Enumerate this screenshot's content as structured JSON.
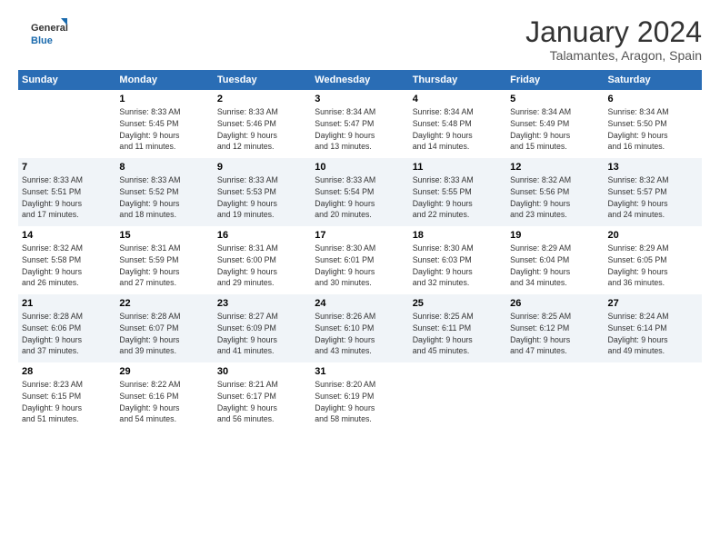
{
  "logo": {
    "line1": "General",
    "line2": "Blue"
  },
  "title": "January 2024",
  "subtitle": "Talamantes, Aragon, Spain",
  "days_header": [
    "Sunday",
    "Monday",
    "Tuesday",
    "Wednesday",
    "Thursday",
    "Friday",
    "Saturday"
  ],
  "weeks": [
    [
      {
        "day": "",
        "info": ""
      },
      {
        "day": "1",
        "info": "Sunrise: 8:33 AM\nSunset: 5:45 PM\nDaylight: 9 hours\nand 11 minutes."
      },
      {
        "day": "2",
        "info": "Sunrise: 8:33 AM\nSunset: 5:46 PM\nDaylight: 9 hours\nand 12 minutes."
      },
      {
        "day": "3",
        "info": "Sunrise: 8:34 AM\nSunset: 5:47 PM\nDaylight: 9 hours\nand 13 minutes."
      },
      {
        "day": "4",
        "info": "Sunrise: 8:34 AM\nSunset: 5:48 PM\nDaylight: 9 hours\nand 14 minutes."
      },
      {
        "day": "5",
        "info": "Sunrise: 8:34 AM\nSunset: 5:49 PM\nDaylight: 9 hours\nand 15 minutes."
      },
      {
        "day": "6",
        "info": "Sunrise: 8:34 AM\nSunset: 5:50 PM\nDaylight: 9 hours\nand 16 minutes."
      }
    ],
    [
      {
        "day": "7",
        "info": "Sunrise: 8:33 AM\nSunset: 5:51 PM\nDaylight: 9 hours\nand 17 minutes."
      },
      {
        "day": "8",
        "info": "Sunrise: 8:33 AM\nSunset: 5:52 PM\nDaylight: 9 hours\nand 18 minutes."
      },
      {
        "day": "9",
        "info": "Sunrise: 8:33 AM\nSunset: 5:53 PM\nDaylight: 9 hours\nand 19 minutes."
      },
      {
        "day": "10",
        "info": "Sunrise: 8:33 AM\nSunset: 5:54 PM\nDaylight: 9 hours\nand 20 minutes."
      },
      {
        "day": "11",
        "info": "Sunrise: 8:33 AM\nSunset: 5:55 PM\nDaylight: 9 hours\nand 22 minutes."
      },
      {
        "day": "12",
        "info": "Sunrise: 8:32 AM\nSunset: 5:56 PM\nDaylight: 9 hours\nand 23 minutes."
      },
      {
        "day": "13",
        "info": "Sunrise: 8:32 AM\nSunset: 5:57 PM\nDaylight: 9 hours\nand 24 minutes."
      }
    ],
    [
      {
        "day": "14",
        "info": "Sunrise: 8:32 AM\nSunset: 5:58 PM\nDaylight: 9 hours\nand 26 minutes."
      },
      {
        "day": "15",
        "info": "Sunrise: 8:31 AM\nSunset: 5:59 PM\nDaylight: 9 hours\nand 27 minutes."
      },
      {
        "day": "16",
        "info": "Sunrise: 8:31 AM\nSunset: 6:00 PM\nDaylight: 9 hours\nand 29 minutes."
      },
      {
        "day": "17",
        "info": "Sunrise: 8:30 AM\nSunset: 6:01 PM\nDaylight: 9 hours\nand 30 minutes."
      },
      {
        "day": "18",
        "info": "Sunrise: 8:30 AM\nSunset: 6:03 PM\nDaylight: 9 hours\nand 32 minutes."
      },
      {
        "day": "19",
        "info": "Sunrise: 8:29 AM\nSunset: 6:04 PM\nDaylight: 9 hours\nand 34 minutes."
      },
      {
        "day": "20",
        "info": "Sunrise: 8:29 AM\nSunset: 6:05 PM\nDaylight: 9 hours\nand 36 minutes."
      }
    ],
    [
      {
        "day": "21",
        "info": "Sunrise: 8:28 AM\nSunset: 6:06 PM\nDaylight: 9 hours\nand 37 minutes."
      },
      {
        "day": "22",
        "info": "Sunrise: 8:28 AM\nSunset: 6:07 PM\nDaylight: 9 hours\nand 39 minutes."
      },
      {
        "day": "23",
        "info": "Sunrise: 8:27 AM\nSunset: 6:09 PM\nDaylight: 9 hours\nand 41 minutes."
      },
      {
        "day": "24",
        "info": "Sunrise: 8:26 AM\nSunset: 6:10 PM\nDaylight: 9 hours\nand 43 minutes."
      },
      {
        "day": "25",
        "info": "Sunrise: 8:25 AM\nSunset: 6:11 PM\nDaylight: 9 hours\nand 45 minutes."
      },
      {
        "day": "26",
        "info": "Sunrise: 8:25 AM\nSunset: 6:12 PM\nDaylight: 9 hours\nand 47 minutes."
      },
      {
        "day": "27",
        "info": "Sunrise: 8:24 AM\nSunset: 6:14 PM\nDaylight: 9 hours\nand 49 minutes."
      }
    ],
    [
      {
        "day": "28",
        "info": "Sunrise: 8:23 AM\nSunset: 6:15 PM\nDaylight: 9 hours\nand 51 minutes."
      },
      {
        "day": "29",
        "info": "Sunrise: 8:22 AM\nSunset: 6:16 PM\nDaylight: 9 hours\nand 54 minutes."
      },
      {
        "day": "30",
        "info": "Sunrise: 8:21 AM\nSunset: 6:17 PM\nDaylight: 9 hours\nand 56 minutes."
      },
      {
        "day": "31",
        "info": "Sunrise: 8:20 AM\nSunset: 6:19 PM\nDaylight: 9 hours\nand 58 minutes."
      },
      {
        "day": "",
        "info": ""
      },
      {
        "day": "",
        "info": ""
      },
      {
        "day": "",
        "info": ""
      }
    ]
  ]
}
